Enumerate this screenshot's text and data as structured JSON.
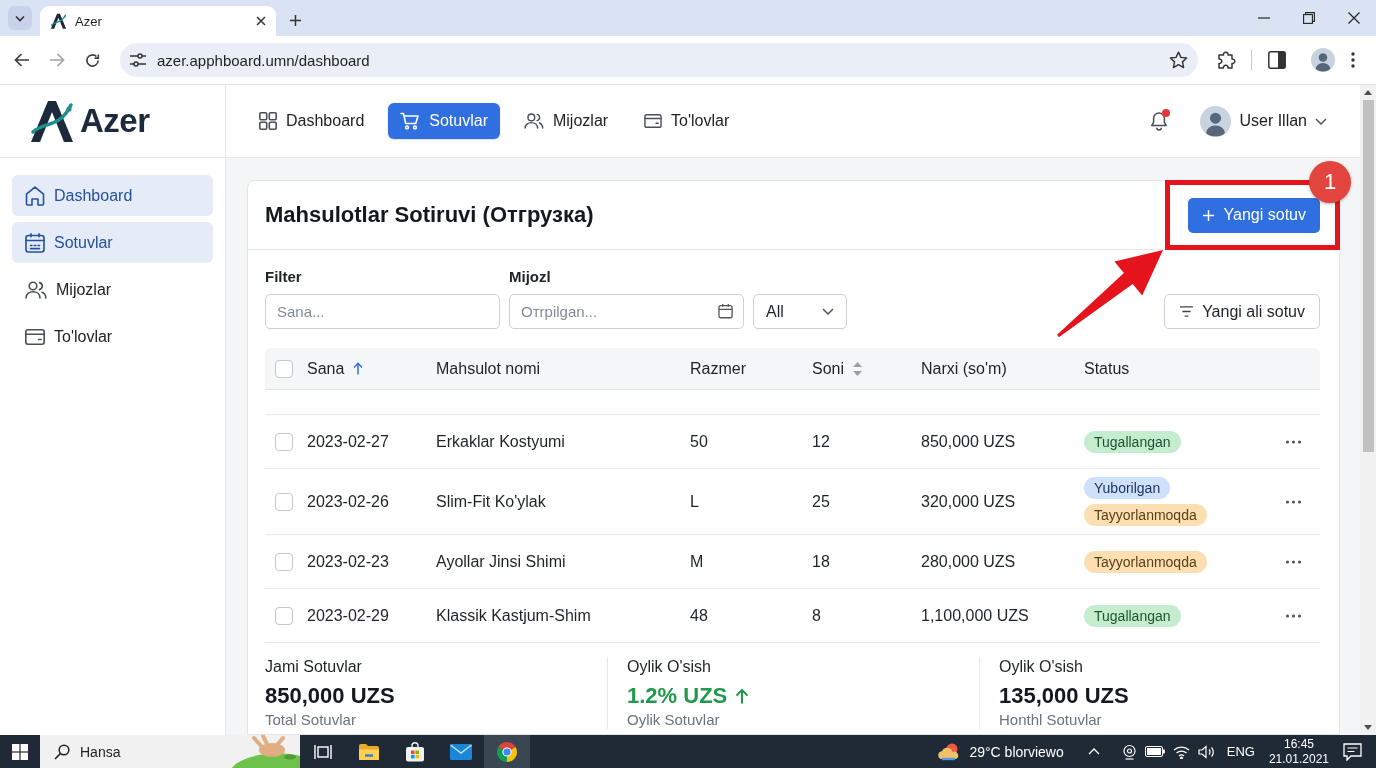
{
  "browser": {
    "tab": {
      "title": "Azer"
    },
    "address": "azer.apphboard.umn/dashboard"
  },
  "header": {
    "logo": "Azer",
    "nav": [
      {
        "label": "Dashboard",
        "selected": false
      },
      {
        "label": "Sotuvlar",
        "selected": true
      },
      {
        "label": "Mijozlar",
        "selected": false
      },
      {
        "label": "To'lovlar",
        "selected": false
      }
    ],
    "notifications": {
      "unread": true
    },
    "user": {
      "name": "User Illan"
    }
  },
  "sidebar": {
    "items": [
      {
        "label": "Dashboard",
        "selected": true
      },
      {
        "label": "Sotuvlar",
        "selected": true
      },
      {
        "label": "Mijozlar",
        "selected": false
      },
      {
        "label": "To'lovlar",
        "selected": false
      }
    ]
  },
  "page": {
    "title": "Mahsulotlar Sotiruvi (Отгрузка)",
    "primary_action": {
      "label": "Yangi sotuv"
    },
    "annotation": {
      "step": "1"
    },
    "filters": [
      {
        "kind": "text",
        "label": "Filter",
        "placeholder": "Sana..."
      },
      {
        "kind": "date",
        "label": "Mijozl",
        "placeholder": "Отrpilgan..."
      },
      {
        "kind": "select",
        "value": "All"
      }
    ],
    "filter_action": {
      "label": "Yangi ali sotuv"
    },
    "table": {
      "select_all": {
        "checked": false
      },
      "columns": [
        {
          "label": "Sana",
          "sortable": true,
          "sorted": true
        },
        {
          "label": "Mahsulot nomi",
          "sortable": false,
          "sorted": false
        },
        {
          "label": "Razmer",
          "sortable": false,
          "sorted": false
        },
        {
          "label": "Soni",
          "sortable": true,
          "sorted": false
        },
        {
          "label": "Narxi (so'm)",
          "sortable": false,
          "sorted": false
        },
        {
          "label": "Status",
          "sortable": false,
          "sorted": false
        }
      ],
      "rows": [
        {
          "checked": false,
          "cells": [
            "2023-02-27",
            "Erkaklar Kostyumi",
            "50",
            "12",
            "850,000 UZS"
          ],
          "statuses": [
            {
              "label": "Tugallangan",
              "color": "#c6ecd0"
            }
          ]
        },
        {
          "checked": false,
          "cells": [
            "2023-02-26",
            "Slim-Fit Ko'ylak",
            "L",
            "25",
            "320,000 UZS"
          ],
          "statuses": [
            {
              "label": "Yuborilgan",
              "color": "#cfe0fa"
            },
            {
              "label": "Tayyorlanmoqda",
              "color": "#fbdfb1"
            }
          ]
        },
        {
          "checked": false,
          "cells": [
            "2023-02-23",
            "Ayollar Jinsi Shimi",
            "M",
            "18",
            "280,000 UZS"
          ],
          "statuses": [
            {
              "label": "Tayyorlanmoqda",
              "color": "#fbdfb1"
            }
          ]
        },
        {
          "checked": false,
          "cells": [
            "2023-02-29",
            "Klassik Kastjum-Shim",
            "48",
            "8",
            "1,100,000 UZS"
          ],
          "statuses": [
            {
              "label": "Tugallangan",
              "color": "#c6ecd0"
            }
          ]
        }
      ]
    },
    "stats": [
      {
        "label": "Jami Sotuvlar",
        "value": "850,000 UZS",
        "rising": false,
        "note": "Total Sotuvlar"
      },
      {
        "label": "Oylik O'sish",
        "value": "1.2% UZS",
        "rising": true,
        "note": "Oylik Sotuvlar"
      },
      {
        "label": "Oylik O'sish",
        "value": "135,000 UZS",
        "rising": false,
        "note": "Honthl Sotuvlar"
      }
    ]
  },
  "taskbar": {
    "search": "Hansa",
    "apps": [
      {
        "kind": "task-view",
        "active": false
      },
      {
        "kind": "explorer",
        "active": false
      },
      {
        "kind": "store",
        "active": false
      },
      {
        "kind": "mail",
        "active": false
      },
      {
        "kind": "browser",
        "active": true
      }
    ],
    "weather": "29°C blorviewo",
    "language": "ENG",
    "time": "16:45",
    "date": "21.01.2021"
  }
}
